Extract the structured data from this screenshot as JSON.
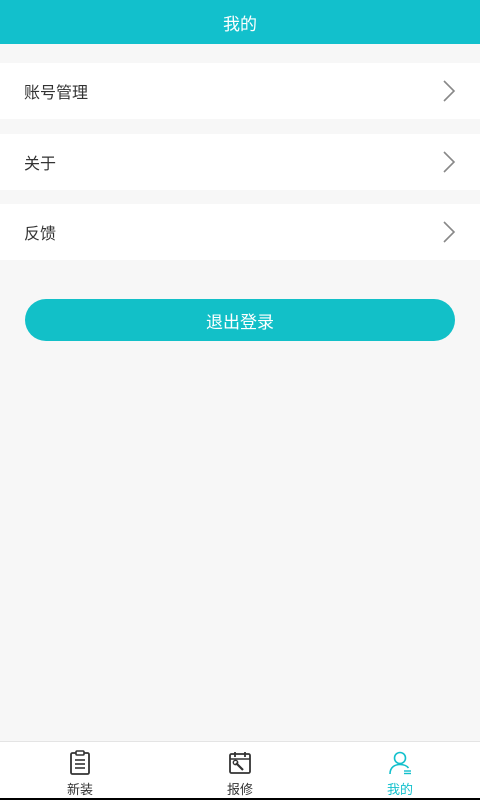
{
  "header": {
    "title": "我的"
  },
  "menu": [
    {
      "label": "账号管理",
      "icon": "chevron-right-icon"
    },
    {
      "label": "关于",
      "icon": "chevron-right-icon"
    },
    {
      "label": "反馈",
      "icon": "chevron-right-icon"
    }
  ],
  "logout": {
    "label": "退出登录"
  },
  "tabbar": {
    "items": [
      {
        "label": "新装",
        "icon": "clipboard-icon",
        "active": false
      },
      {
        "label": "报修",
        "icon": "calendar-wrench-icon",
        "active": false
      },
      {
        "label": "我的",
        "icon": "user-icon",
        "active": true
      }
    ]
  },
  "colors": {
    "accent": "#12c0cc",
    "text": "#333333",
    "background": "#f7f7f7"
  }
}
